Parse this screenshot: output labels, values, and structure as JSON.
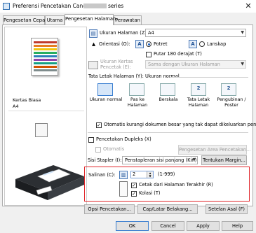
{
  "window": {
    "title": "Preferensi Pencetakan Canon",
    "title_suffix": "series",
    "close": "✕"
  },
  "tabs": [
    {
      "label": "Pengesetan Cepat"
    },
    {
      "label": "Utama"
    },
    {
      "label": "Pengesetan Halaman"
    },
    {
      "label": "Perawatan"
    }
  ],
  "preview": {
    "media_name": "Kertas Biasa",
    "media_size": "A4"
  },
  "page_size": {
    "label": "Ukuran Halaman (Z):",
    "value": "A4"
  },
  "orientation": {
    "label": "Orientasi (O):",
    "portrait": "Potret",
    "landscape": "Lanskap",
    "rotate_180": "Putar 180 derajat (T)",
    "portrait_glyph": "A",
    "landscape_glyph": "A"
  },
  "printer_paper_size": {
    "label": "Ukuran Kertas Pencetak (E):",
    "value": "Sama dengan Ukuran Halaman"
  },
  "page_layout": {
    "label": "Tata Letak Halaman (Y):",
    "value": "Ukuran normal",
    "options": [
      {
        "label": "Ukuran normal",
        "glyph": ""
      },
      {
        "label": "Pas ke Halaman",
        "glyph": ""
      },
      {
        "label": "Berskala",
        "glyph": ""
      },
      {
        "label": "Tata Letak Halaman",
        "glyph": "2"
      },
      {
        "label": "Pengubinan / Poster",
        "glyph": "2"
      }
    ]
  },
  "auto_reduce": {
    "label": "Otomatis kurangi dokumen besar yang tak dapat dikeluarkan pencetak",
    "checked": true,
    "glyph": "✓"
  },
  "duplex": {
    "label": "Pencetakan Dupleks (X)",
    "checked": false,
    "automatic_label": "Otomatis",
    "area_button": "Pengesetan Area Pencetakan..."
  },
  "stapling": {
    "label": "Sisi Stapler (I):",
    "value": "Penstapleran sisi panjang (Kiri)",
    "margin_button": "Tentukan Margin..."
  },
  "copies": {
    "label": "Salinan (C):",
    "value": "2",
    "range": "(1-999)",
    "last_page_first_label": "Cetak dari Halaman Terakhir (R)",
    "last_page_first_checked": true,
    "collate_label": "Kolasi (T)",
    "collate_checked": true,
    "check_glyph": "✓",
    "up_glyph": "▲",
    "down_glyph": "▼"
  },
  "bottom_buttons": {
    "print_options": "Opsi Penceta­kan...",
    "stamp_background": "Cap/Latar Belakang...",
    "defaults": "Setelan Asal (F)"
  },
  "dialog_buttons": {
    "ok": "OK",
    "cancel": "Cancel",
    "apply": "Apply",
    "help": "Help"
  }
}
